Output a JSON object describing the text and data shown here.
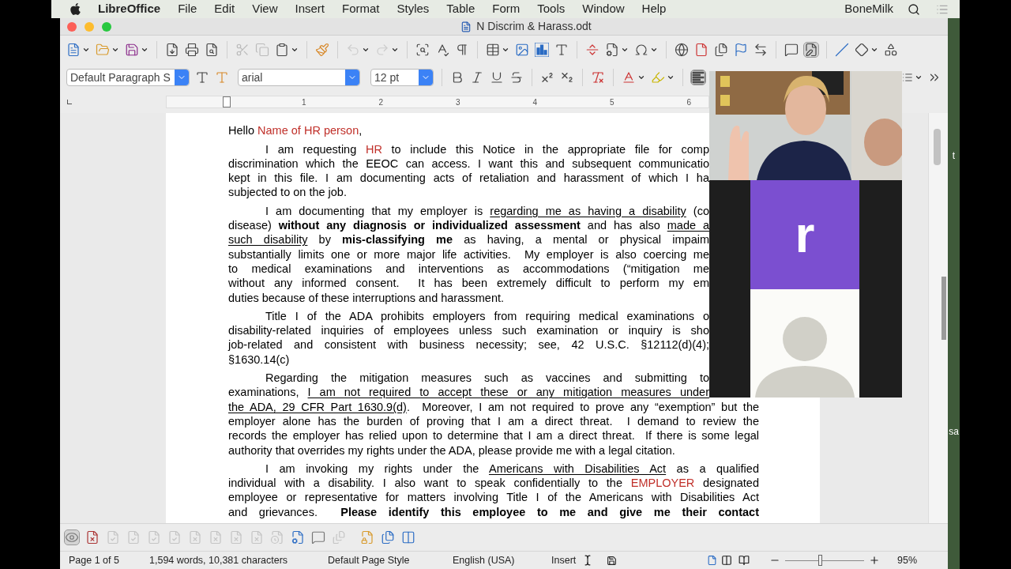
{
  "menu_bar": {
    "app": "LibreOffice",
    "items": [
      "File",
      "Edit",
      "View",
      "Insert",
      "Format",
      "Styles",
      "Table",
      "Form",
      "Tools",
      "Window",
      "Help"
    ],
    "user": "BoneMilk"
  },
  "window": {
    "title": "N Discrim & Harass.odt"
  },
  "toolbar": {
    "track_changes": {
      "on": true
    }
  },
  "formatting_bar": {
    "paragraph_style": "Default Paragraph S",
    "font": "arial",
    "size": "12 pt",
    "align_left": {
      "selected": true
    }
  },
  "ruler": {
    "marks": [
      "1",
      "2",
      "3",
      "4",
      "5",
      "6"
    ]
  },
  "document": {
    "paragraphs": [
      {
        "indent": false,
        "lines": [
          {
            "justified": false,
            "covered": false,
            "runs": [
              {
                "kind": "plain",
                "text": "Hello "
              },
              {
                "kind": "red",
                "text": "Name of HR person"
              },
              {
                "kind": "plain",
                "text": ","
              }
            ]
          }
        ]
      },
      {
        "indent": true,
        "lines": [
          {
            "justified": true,
            "covered": true,
            "runs": [
              {
                "kind": "plain",
                "text": "I am requesting "
              },
              {
                "kind": "red",
                "text": "HR"
              },
              {
                "kind": "plain",
                "text": " to include this Notice in the appropriate file for comp"
              }
            ]
          },
          {
            "justified": true,
            "covered": true,
            "runs": [
              {
                "kind": "plain",
                "text": "discrimination which the EEOC can access. I want this and subsequent communicatio"
              }
            ]
          },
          {
            "justified": true,
            "covered": true,
            "runs": [
              {
                "kind": "plain",
                "text": "kept in this file. I am documenting acts of retaliation and harassment of which I ha"
              }
            ]
          },
          {
            "justified": false,
            "covered": false,
            "runs": [
              {
                "kind": "plain",
                "text": "subjected to on the job."
              }
            ]
          }
        ]
      },
      {
        "indent": true,
        "lines": [
          {
            "justified": true,
            "covered": true,
            "runs": [
              {
                "kind": "plain",
                "text": "I am documenting that my employer is "
              },
              {
                "kind": "underline",
                "text": "regarding me as having a disability"
              },
              {
                "kind": "plain",
                "text": " (co"
              }
            ]
          },
          {
            "justified": true,
            "covered": true,
            "runs": [
              {
                "kind": "plain",
                "text": "disease) "
              },
              {
                "kind": "bold",
                "text": "without any diagnosis or individualized assessment"
              },
              {
                "kind": "plain",
                "text": " and has also "
              },
              {
                "kind": "underline",
                "text": "made a"
              }
            ]
          },
          {
            "justified": true,
            "covered": true,
            "runs": [
              {
                "kind": "underline",
                "text": "such disability"
              },
              {
                "kind": "plain",
                "text": " by "
              },
              {
                "kind": "bold",
                "text": "mis-classifying me"
              },
              {
                "kind": "plain",
                "text": " as having, a mental or physical impaim"
              }
            ]
          },
          {
            "justified": true,
            "covered": true,
            "runs": [
              {
                "kind": "plain",
                "text": "substantially limits one or more major life activities.  My employer is also coercing me"
              }
            ]
          },
          {
            "justified": true,
            "covered": true,
            "runs": [
              {
                "kind": "plain",
                "text": "to medical examinations and interventions as accommodations (“mitigation me"
              }
            ]
          },
          {
            "justified": true,
            "covered": true,
            "runs": [
              {
                "kind": "plain",
                "text": "without any informed consent.  It has been extremely difficult to perform my em"
              }
            ]
          },
          {
            "justified": false,
            "covered": false,
            "runs": [
              {
                "kind": "plain",
                "text": "duties because of these interruptions and harassment."
              }
            ]
          }
        ]
      },
      {
        "indent": true,
        "lines": [
          {
            "justified": true,
            "covered": true,
            "runs": [
              {
                "kind": "plain",
                "text": "Title I of the ADA prohibits employers from requiring medical examinations o"
              }
            ]
          },
          {
            "justified": true,
            "covered": true,
            "runs": [
              {
                "kind": "plain",
                "text": "disability-related inquiries of employees unless such examination or inquiry is sho"
              }
            ]
          },
          {
            "justified": true,
            "covered": true,
            "runs": [
              {
                "kind": "plain",
                "text": "job-related and consistent with business necessity; see, 42 U.S.C. §12112(d)(4);"
              }
            ]
          },
          {
            "covered": false,
            "runs": [
              {
                "kind": "plain",
                "text": "§1630.14(c)"
              }
            ]
          }
        ]
      },
      {
        "indent": true,
        "lines": [
          {
            "justified": true,
            "covered": true,
            "runs": [
              {
                "kind": "plain",
                "text": "Regarding the mitigation measures such as vaccines and submitting to"
              }
            ]
          },
          {
            "justified": true,
            "covered": true,
            "runs": [
              {
                "kind": "plain",
                "text": "examinations, "
              },
              {
                "kind": "underline",
                "text": "I am not required to accept these or any mitigation measures under"
              }
            ]
          },
          {
            "justified": true,
            "covered": false,
            "runs": [
              {
                "kind": "underline",
                "text": "the ADA, 29 CFR Part 1630.9(d)"
              },
              {
                "kind": "plain",
                "text": ".  Moreover, I am not required to prove any “exemption” but the"
              }
            ]
          },
          {
            "justified": true,
            "covered": false,
            "runs": [
              {
                "kind": "plain",
                "text": "employer alone has the burden of proving that I am a direct threat.  I demand to review the"
              }
            ]
          },
          {
            "justified": true,
            "covered": false,
            "runs": [
              {
                "kind": "plain",
                "text": "records the employer has relied upon to determine that I am a direct threat.  If there is some legal"
              }
            ]
          },
          {
            "justified": false,
            "covered": false,
            "runs": [
              {
                "kind": "plain",
                "text": "authority that overrides my rights under the ADA, please provide me with a legal citation."
              }
            ]
          }
        ]
      },
      {
        "indent": true,
        "lines": [
          {
            "justified": true,
            "covered": false,
            "runs": [
              {
                "kind": "plain",
                "text": "I am invoking my rights under the "
              },
              {
                "kind": "underline",
                "text": "Americans with Disabilities Act"
              },
              {
                "kind": "plain",
                "text": " as a qualified"
              }
            ]
          },
          {
            "justified": true,
            "covered": false,
            "runs": [
              {
                "kind": "plain",
                "text": "individual with a disability. I also want to speak confidentially to the "
              },
              {
                "kind": "red",
                "text": "EMPLOYER"
              },
              {
                "kind": "plain",
                "text": " designated"
              }
            ]
          },
          {
            "justified": true,
            "covered": false,
            "runs": [
              {
                "kind": "plain",
                "text": "employee or representative for matters involving Title I of the Americans with Disabilities Act"
              }
            ]
          },
          {
            "justified": true,
            "covered": false,
            "runs": [
              {
                "kind": "plain",
                "text": "and grievances.  "
              },
              {
                "kind": "bold",
                "text": "Please identify this employee to me and give me their contact"
              }
            ]
          }
        ]
      }
    ]
  },
  "changes_bar": {
    "show_changes": {
      "on": true
    }
  },
  "status_bar": {
    "page": "Page 1 of 5",
    "counts": "1,594 words, 10,381 characters",
    "page_style": "Default Page Style",
    "language": "English (USA)",
    "mode": "Insert",
    "zoom": {
      "level": 0.44
    },
    "zoom_percent": "95%"
  },
  "video_call": {
    "tiles": [
      {
        "kind": "picture"
      },
      {
        "kind": "initial",
        "text": "r",
        "color": "#7b4fd0"
      },
      {
        "kind": "avatar"
      }
    ]
  },
  "desktop_labels": [
    "t",
    "sa"
  ]
}
